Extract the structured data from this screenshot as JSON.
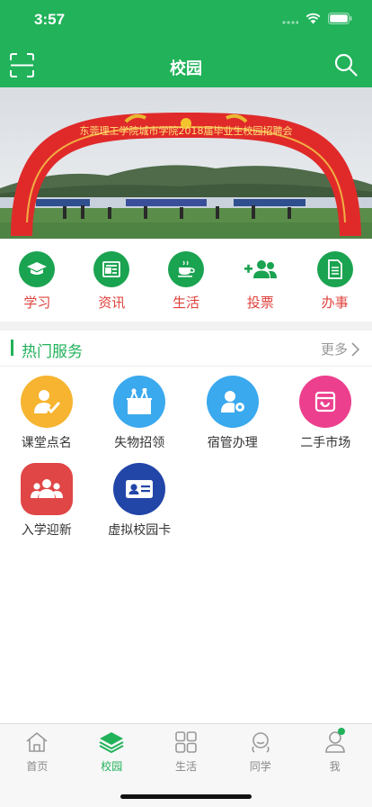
{
  "status_bar": {
    "time": "3:57"
  },
  "navbar": {
    "title": "校园"
  },
  "banner": {
    "arch_text": "东莞理工学院城市学院2018届毕业生校园招聘会"
  },
  "quick_actions": [
    {
      "label": "学习",
      "icon": "graduation-cap-icon"
    },
    {
      "label": "资讯",
      "icon": "newspaper-icon"
    },
    {
      "label": "生活",
      "icon": "coffee-cup-icon"
    },
    {
      "label": "投票",
      "icon": "add-group-icon"
    },
    {
      "label": "办事",
      "icon": "document-icon"
    }
  ],
  "hot_services": {
    "title": "热门服务",
    "more_label": "更多",
    "items": [
      {
        "label": "课堂点名",
        "icon": "attendance-icon",
        "color": "#f6b430"
      },
      {
        "label": "失物招领",
        "icon": "lost-found-icon",
        "color": "#3aa9ee"
      },
      {
        "label": "宿管办理",
        "icon": "dorm-manage-icon",
        "color": "#3aa9ee"
      },
      {
        "label": "二手市场",
        "icon": "secondhand-market-icon",
        "color": "#ec3f8e"
      },
      {
        "label": "入学迎新",
        "icon": "freshmen-welcome-icon",
        "color": "#e04646"
      },
      {
        "label": "虚拟校园卡",
        "icon": "campus-card-icon",
        "color": "#2245a8"
      }
    ]
  },
  "tabbar": [
    {
      "label": "首页",
      "icon": "home-icon",
      "active": false
    },
    {
      "label": "校园",
      "icon": "layers-icon",
      "active": true
    },
    {
      "label": "生活",
      "icon": "grid-icon",
      "active": false
    },
    {
      "label": "同学",
      "icon": "classmate-icon",
      "active": false
    },
    {
      "label": "我",
      "icon": "profile-icon",
      "active": false,
      "badge_dot": true
    }
  ],
  "colors": {
    "primary": "#21b25a",
    "quick_label": "#e0413b"
  }
}
